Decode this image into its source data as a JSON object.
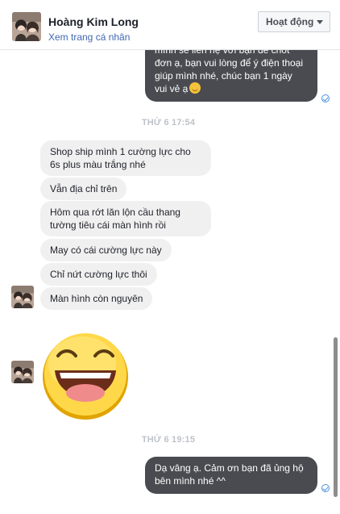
{
  "header": {
    "contact_name": "Hoàng Kim Long",
    "profile_link": "Xem trang cá nhân",
    "status_button": "Hoạt động"
  },
  "messages": {
    "out_1": "mình sẽ liên hệ với bạn để chốt đơn ạ, bạn vui lòng để ý điện thoại giúp mình nhé, chúc bạn 1 ngày vui vẻ ạ",
    "out_1_line1": "mình sẽ liên hệ với bạn để chốt",
    "out_1_line2": "đơn ạ, bạn vui lòng để ý điện thoại",
    "out_1_line3": "giúp mình nhé, chúc bạn 1 ngày",
    "out_1_line4": "vui vẻ ạ",
    "timestamp_1": "THỨ 6 17:54",
    "in_1": "Shop ship mình 1 cường lực cho 6s plus màu trắng nhé",
    "in_1_line1": "Shop ship mình 1 cường lực cho",
    "in_1_line2": "6s plus màu trắng nhé",
    "in_2": "Vẫn địa chỉ trên",
    "in_3": "Hôm qua rớt lăn lộn cầu thang tường tiêu cái màn hình rồi",
    "in_3_line1": "Hôm qua rớt lăn lộn cầu thang",
    "in_3_line2": "tường tiêu cái màn hình rồi",
    "in_4": "May có cái cường lực này",
    "in_5": "Chỉ nứt cường lực thôi",
    "in_6": "Màn hình còn nguyên",
    "timestamp_2": "THỨ 6 19:15",
    "out_2": "Dạ vâng ạ. Cảm ơn bạn đã ủng hộ bên mình nhé ^^",
    "out_2_line1": "Dạ vâng ạ. Cảm ơn bạn đã ủng hộ",
    "out_2_line2": "bên mình nhé ^^"
  },
  "icons": {
    "sticker": "laughing-face-sticker",
    "read_receipt": "check-circle-icon",
    "emoji": "smiling-face-emoji"
  },
  "colors": {
    "outgoing_bubble": "#4a4b51",
    "incoming_bubble": "#f1f0f0",
    "link": "#4267b2",
    "read_receipt": "#4a90e2"
  }
}
